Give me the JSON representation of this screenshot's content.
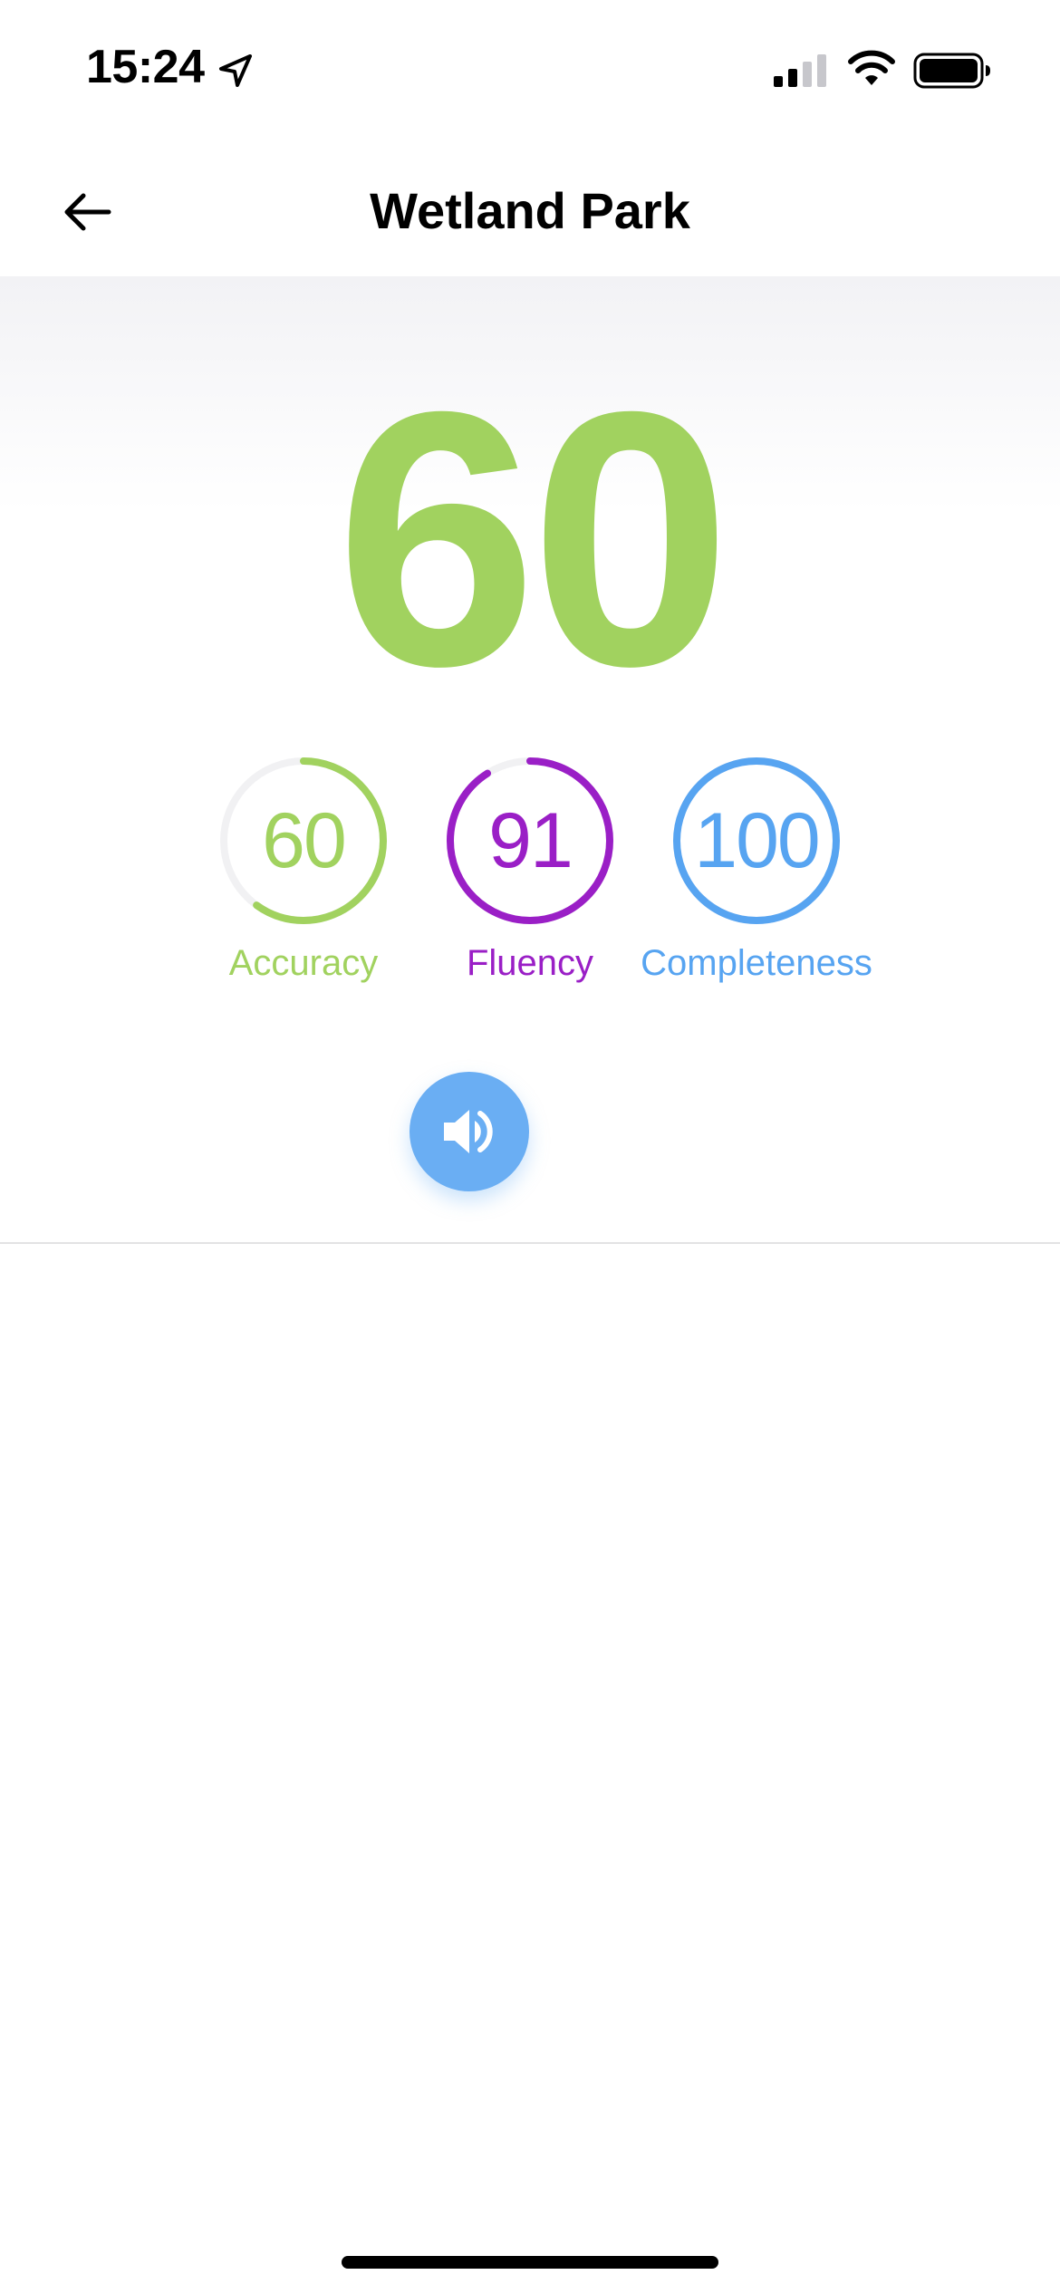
{
  "status_bar": {
    "time": "15:24",
    "icons": [
      "location-arrow-icon",
      "cellular-signal-icon",
      "wifi-icon",
      "battery-icon"
    ]
  },
  "nav": {
    "title": "Wetland Park",
    "back_icon": "arrow-left-icon"
  },
  "overall": {
    "score": "60",
    "color": "#a1d25f"
  },
  "metrics": [
    {
      "label": "Accuracy",
      "value": "60",
      "progress": 0.6,
      "color": "#a1d25f"
    },
    {
      "label": "Fluency",
      "value": "91",
      "progress": 0.91,
      "color": "#9a1fc6"
    },
    {
      "label": "Completeness",
      "value": "100",
      "progress": 1.0,
      "color": "#57a4f1"
    }
  ],
  "play_button": {
    "icon": "speaker-icon",
    "color": "#6aaef3"
  }
}
